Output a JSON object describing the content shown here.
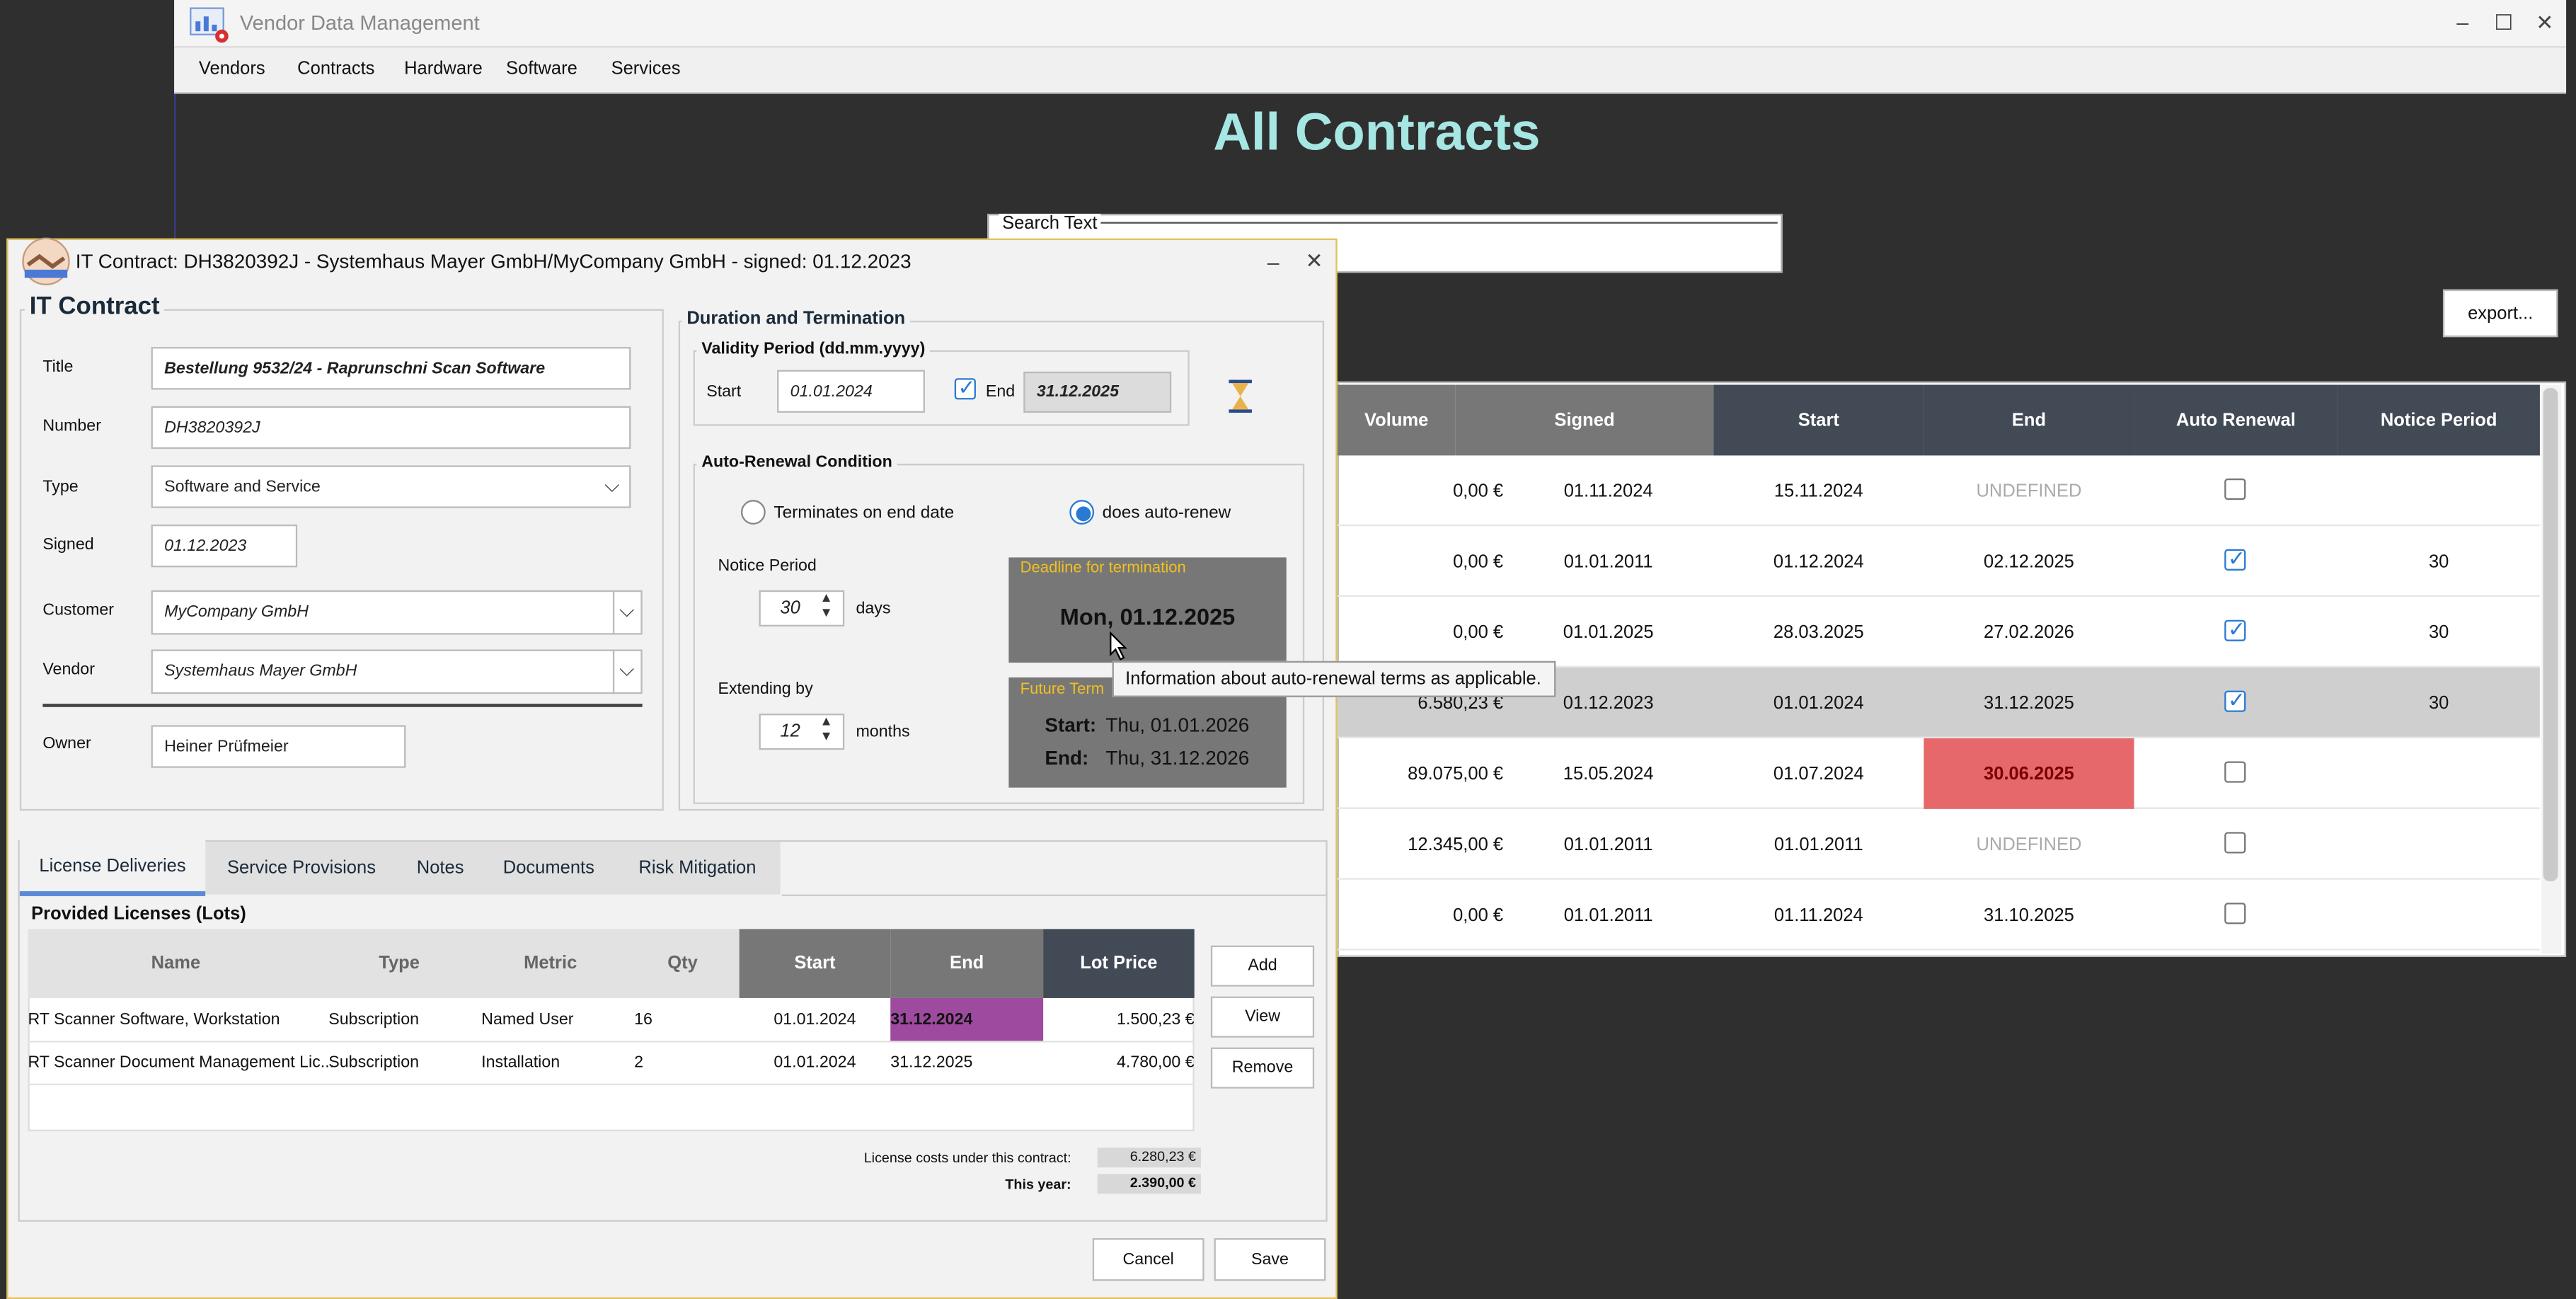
{
  "main": {
    "app_title": "Vendor Data Management",
    "menu": [
      "Vendors",
      "Contracts",
      "Hardware",
      "Software",
      "Services"
    ],
    "heading": "All Contracts",
    "search_legend": "Search Text",
    "export_label": "export...",
    "columns": [
      "Volume",
      "Signed",
      "Start",
      "End",
      "Auto Renewal",
      "Notice Period"
    ],
    "rows": [
      {
        "volume": "0,00 €",
        "signed": "01.11.2024",
        "start": "15.11.2024",
        "end": "UNDEFINED",
        "auto": false,
        "notice": ""
      },
      {
        "volume": "0,00 €",
        "signed": "01.01.2011",
        "start": "01.12.2024",
        "end": "02.12.2025",
        "auto": true,
        "notice": "30"
      },
      {
        "volume": "0,00 €",
        "signed": "01.01.2025",
        "start": "28.03.2025",
        "end": "27.02.2026",
        "auto": true,
        "notice": "30"
      },
      {
        "volume": "6.580,23 €",
        "signed": "01.12.2023",
        "start": "01.01.2024",
        "end": "31.12.2025",
        "auto": true,
        "notice": "30"
      },
      {
        "volume": "89.075,00 €",
        "signed": "15.05.2024",
        "start": "01.07.2024",
        "end": "30.06.2025",
        "auto": false,
        "notice": ""
      },
      {
        "volume": "12.345,00 €",
        "signed": "01.01.2011",
        "start": "01.01.2011",
        "end": "UNDEFINED",
        "auto": false,
        "notice": ""
      },
      {
        "volume": "0,00 €",
        "signed": "01.01.2011",
        "start": "01.11.2024",
        "end": "31.10.2025",
        "auto": false,
        "notice": ""
      }
    ]
  },
  "dialog": {
    "title": "IT Contract: DH3820392J - Systemhaus Mayer GmbH/MyCompany GmbH - signed: 01.12.2023",
    "section": "IT Contract",
    "fields": {
      "title_label": "Title",
      "title_value": "Bestellung 9532/24 - Raprunschni Scan Software",
      "number_label": "Number",
      "number_value": "DH3820392J",
      "type_label": "Type",
      "type_value": "Software and Service",
      "signed_label": "Signed",
      "signed_value": "01.12.2023",
      "customer_label": "Customer",
      "customer_value": "MyCompany GmbH",
      "vendor_label": "Vendor",
      "vendor_value": "Systemhaus Mayer GmbH",
      "owner_label": "Owner",
      "owner_value": "Heiner Prüfmeier"
    },
    "duration": {
      "title": "Duration and Termination",
      "validity_title": "Validity Period (dd.mm.yyyy)",
      "start_label": "Start",
      "start_value": "01.01.2024",
      "end_label": "End",
      "end_value": "31.12.2025",
      "auto_title": "Auto-Renewal Condition",
      "radio_terminates": "Terminates on end date",
      "radio_autorenew": "does auto-renew",
      "notice_label": "Notice Period",
      "notice_value": "30",
      "notice_unit": "days",
      "extend_label": "Extending by",
      "extend_value": "12",
      "extend_unit": "months",
      "deadline_title": "Deadline for termination",
      "deadline_value": "Mon, 01.12.2025",
      "future_title": "Future Term",
      "future_start_label": "Start:",
      "future_start_value": "Thu, 01.01.2026",
      "future_end_label": "End:",
      "future_end_value": "Thu, 31.12.2026",
      "tooltip": "Information about auto-renewal terms as applicable."
    },
    "tabs": [
      "License Deliveries",
      "Service Provisions",
      "Notes",
      "Documents",
      "Risk Mitigation"
    ],
    "licenses": {
      "title": "Provided Licenses (Lots)",
      "columns": [
        "Name",
        "Type",
        "Metric",
        "Qty",
        "Start",
        "End",
        "Lot Price"
      ],
      "rows": [
        {
          "name": "RT Scanner Software, Workstation",
          "type": "Subscription",
          "metric": "Named User",
          "qty": "16",
          "start": "01.01.2024",
          "end": "31.12.2024",
          "price": "1.500,23 €"
        },
        {
          "name": "RT Scanner Document Management Lic...",
          "type": "Subscription",
          "metric": "Installation",
          "qty": "2",
          "start": "01.01.2024",
          "end": "31.12.2025",
          "price": "4.780,00 €"
        }
      ],
      "costs_label": "License costs under this contract:",
      "costs_value": "6.280,23 €",
      "year_label": "This year:",
      "year_value": "2.390,00 €",
      "add": "Add",
      "view": "View",
      "remove": "Remove"
    },
    "cancel": "Cancel",
    "save": "Save"
  }
}
